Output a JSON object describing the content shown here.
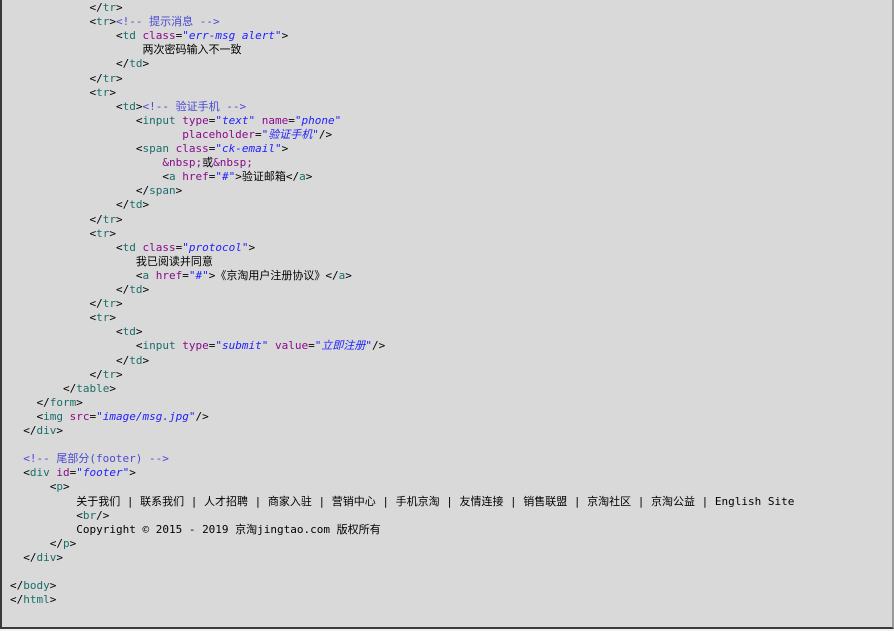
{
  "lines": [
    [
      {
        "t": "            ",
        "c": "sy"
      },
      {
        "t": "</",
        "c": "sy"
      },
      {
        "t": "tr",
        "c": "tg"
      },
      {
        "t": ">",
        "c": "sy"
      }
    ],
    [
      {
        "t": "            ",
        "c": "sy"
      },
      {
        "t": "<",
        "c": "sy"
      },
      {
        "t": "tr",
        "c": "tg"
      },
      {
        "t": ">",
        "c": "sy"
      },
      {
        "t": "<!-- 提示消息 -->",
        "c": "cm"
      }
    ],
    [
      {
        "t": "                ",
        "c": "sy"
      },
      {
        "t": "<",
        "c": "sy"
      },
      {
        "t": "td",
        "c": "tg"
      },
      {
        "t": " class",
        "c": "at"
      },
      {
        "t": "=",
        "c": "sy"
      },
      {
        "t": "\"err-msg alert\"",
        "c": "vl"
      },
      {
        "t": ">",
        "c": "sy"
      }
    ],
    [
      {
        "t": "                    ",
        "c": "sy"
      },
      {
        "t": "两次密码输入不一致",
        "c": "tx"
      }
    ],
    [
      {
        "t": "                ",
        "c": "sy"
      },
      {
        "t": "</",
        "c": "sy"
      },
      {
        "t": "td",
        "c": "tg"
      },
      {
        "t": ">",
        "c": "sy"
      }
    ],
    [
      {
        "t": "            ",
        "c": "sy"
      },
      {
        "t": "</",
        "c": "sy"
      },
      {
        "t": "tr",
        "c": "tg"
      },
      {
        "t": ">",
        "c": "sy"
      }
    ],
    [
      {
        "t": "            ",
        "c": "sy"
      },
      {
        "t": "<",
        "c": "sy"
      },
      {
        "t": "tr",
        "c": "tg"
      },
      {
        "t": ">",
        "c": "sy"
      }
    ],
    [
      {
        "t": "                ",
        "c": "sy"
      },
      {
        "t": "<",
        "c": "sy"
      },
      {
        "t": "td",
        "c": "tg"
      },
      {
        "t": ">",
        "c": "sy"
      },
      {
        "t": "<!-- 验证手机 -->",
        "c": "cm"
      }
    ],
    [
      {
        "t": "                   ",
        "c": "sy"
      },
      {
        "t": "<",
        "c": "sy"
      },
      {
        "t": "input",
        "c": "tg"
      },
      {
        "t": " type",
        "c": "at"
      },
      {
        "t": "=",
        "c": "sy"
      },
      {
        "t": "\"text\"",
        "c": "vl"
      },
      {
        "t": " name",
        "c": "at"
      },
      {
        "t": "=",
        "c": "sy"
      },
      {
        "t": "\"phone\"",
        "c": "vl"
      }
    ],
    [
      {
        "t": "                          ",
        "c": "sy"
      },
      {
        "t": "placeholder",
        "c": "at"
      },
      {
        "t": "=",
        "c": "sy"
      },
      {
        "t": "\"验证手机\"",
        "c": "vl"
      },
      {
        "t": "/>",
        "c": "sy"
      }
    ],
    [
      {
        "t": "                   ",
        "c": "sy"
      },
      {
        "t": "<",
        "c": "sy"
      },
      {
        "t": "span",
        "c": "tg"
      },
      {
        "t": " class",
        "c": "at"
      },
      {
        "t": "=",
        "c": "sy"
      },
      {
        "t": "\"ck-email\"",
        "c": "vl"
      },
      {
        "t": ">",
        "c": "sy"
      }
    ],
    [
      {
        "t": "                       ",
        "c": "sy"
      },
      {
        "t": "&nbsp;",
        "c": "at"
      },
      {
        "t": "或",
        "c": "tx"
      },
      {
        "t": "&nbsp;",
        "c": "at"
      }
    ],
    [
      {
        "t": "                       ",
        "c": "sy"
      },
      {
        "t": "<",
        "c": "sy"
      },
      {
        "t": "a",
        "c": "tg"
      },
      {
        "t": " href",
        "c": "at"
      },
      {
        "t": "=",
        "c": "sy"
      },
      {
        "t": "\"#\"",
        "c": "vl"
      },
      {
        "t": ">",
        "c": "sy"
      },
      {
        "t": "验证邮箱",
        "c": "tx"
      },
      {
        "t": "</",
        "c": "sy"
      },
      {
        "t": "a",
        "c": "tg"
      },
      {
        "t": ">",
        "c": "sy"
      }
    ],
    [
      {
        "t": "                   ",
        "c": "sy"
      },
      {
        "t": "</",
        "c": "sy"
      },
      {
        "t": "span",
        "c": "tg"
      },
      {
        "t": ">",
        "c": "sy"
      }
    ],
    [
      {
        "t": "                ",
        "c": "sy"
      },
      {
        "t": "</",
        "c": "sy"
      },
      {
        "t": "td",
        "c": "tg"
      },
      {
        "t": ">",
        "c": "sy"
      }
    ],
    [
      {
        "t": "            ",
        "c": "sy"
      },
      {
        "t": "</",
        "c": "sy"
      },
      {
        "t": "tr",
        "c": "tg"
      },
      {
        "t": ">",
        "c": "sy"
      }
    ],
    [
      {
        "t": "            ",
        "c": "sy"
      },
      {
        "t": "<",
        "c": "sy"
      },
      {
        "t": "tr",
        "c": "tg"
      },
      {
        "t": ">",
        "c": "sy"
      }
    ],
    [
      {
        "t": "                ",
        "c": "sy"
      },
      {
        "t": "<",
        "c": "sy"
      },
      {
        "t": "td",
        "c": "tg"
      },
      {
        "t": " class",
        "c": "at"
      },
      {
        "t": "=",
        "c": "sy"
      },
      {
        "t": "\"protocol\"",
        "c": "vl"
      },
      {
        "t": ">",
        "c": "sy"
      }
    ],
    [
      {
        "t": "                   ",
        "c": "sy"
      },
      {
        "t": "我已阅读并同意",
        "c": "tx"
      }
    ],
    [
      {
        "t": "                   ",
        "c": "sy"
      },
      {
        "t": "<",
        "c": "sy"
      },
      {
        "t": "a",
        "c": "tg"
      },
      {
        "t": " href",
        "c": "at"
      },
      {
        "t": "=",
        "c": "sy"
      },
      {
        "t": "\"#\"",
        "c": "vl"
      },
      {
        "t": ">",
        "c": "sy"
      },
      {
        "t": "《京淘用户注册协议》",
        "c": "tx"
      },
      {
        "t": "</",
        "c": "sy"
      },
      {
        "t": "a",
        "c": "tg"
      },
      {
        "t": ">",
        "c": "sy"
      }
    ],
    [
      {
        "t": "                ",
        "c": "sy"
      },
      {
        "t": "</",
        "c": "sy"
      },
      {
        "t": "td",
        "c": "tg"
      },
      {
        "t": ">",
        "c": "sy"
      }
    ],
    [
      {
        "t": "            ",
        "c": "sy"
      },
      {
        "t": "</",
        "c": "sy"
      },
      {
        "t": "tr",
        "c": "tg"
      },
      {
        "t": ">",
        "c": "sy"
      }
    ],
    [
      {
        "t": "            ",
        "c": "sy"
      },
      {
        "t": "<",
        "c": "sy"
      },
      {
        "t": "tr",
        "c": "tg"
      },
      {
        "t": ">",
        "c": "sy"
      }
    ],
    [
      {
        "t": "                ",
        "c": "sy"
      },
      {
        "t": "<",
        "c": "sy"
      },
      {
        "t": "td",
        "c": "tg"
      },
      {
        "t": ">",
        "c": "sy"
      }
    ],
    [
      {
        "t": "                   ",
        "c": "sy"
      },
      {
        "t": "<",
        "c": "sy"
      },
      {
        "t": "input",
        "c": "tg"
      },
      {
        "t": " type",
        "c": "at"
      },
      {
        "t": "=",
        "c": "sy"
      },
      {
        "t": "\"submit\"",
        "c": "vl"
      },
      {
        "t": " value",
        "c": "at"
      },
      {
        "t": "=",
        "c": "sy"
      },
      {
        "t": "\"立即注册\"",
        "c": "vl"
      },
      {
        "t": "/>",
        "c": "sy"
      }
    ],
    [
      {
        "t": "                ",
        "c": "sy"
      },
      {
        "t": "</",
        "c": "sy"
      },
      {
        "t": "td",
        "c": "tg"
      },
      {
        "t": ">",
        "c": "sy"
      }
    ],
    [
      {
        "t": "            ",
        "c": "sy"
      },
      {
        "t": "</",
        "c": "sy"
      },
      {
        "t": "tr",
        "c": "tg"
      },
      {
        "t": ">",
        "c": "sy"
      }
    ],
    [
      {
        "t": "        ",
        "c": "sy"
      },
      {
        "t": "</",
        "c": "sy"
      },
      {
        "t": "table",
        "c": "tg"
      },
      {
        "t": ">",
        "c": "sy"
      }
    ],
    [
      {
        "t": "    ",
        "c": "sy"
      },
      {
        "t": "</",
        "c": "sy"
      },
      {
        "t": "form",
        "c": "tg"
      },
      {
        "t": ">",
        "c": "sy"
      }
    ],
    [
      {
        "t": "    ",
        "c": "sy"
      },
      {
        "t": "<",
        "c": "sy"
      },
      {
        "t": "img",
        "c": "tg"
      },
      {
        "t": " src",
        "c": "at"
      },
      {
        "t": "=",
        "c": "sy"
      },
      {
        "t": "\"image/msg.jpg\"",
        "c": "vl"
      },
      {
        "t": "/>",
        "c": "sy"
      }
    ],
    [
      {
        "t": "  ",
        "c": "sy"
      },
      {
        "t": "</",
        "c": "sy"
      },
      {
        "t": "div",
        "c": "tg"
      },
      {
        "t": ">",
        "c": "sy"
      }
    ],
    [],
    [
      {
        "t": "  ",
        "c": "sy"
      },
      {
        "t": "<!-- 尾部分(footer) -->",
        "c": "cm"
      }
    ],
    [
      {
        "t": "  ",
        "c": "sy"
      },
      {
        "t": "<",
        "c": "sy"
      },
      {
        "t": "div",
        "c": "tg"
      },
      {
        "t": " id",
        "c": "at"
      },
      {
        "t": "=",
        "c": "sy"
      },
      {
        "t": "\"footer\"",
        "c": "vl"
      },
      {
        "t": ">",
        "c": "sy"
      }
    ],
    [
      {
        "t": "      ",
        "c": "sy"
      },
      {
        "t": "<",
        "c": "sy"
      },
      {
        "t": "p",
        "c": "tg"
      },
      {
        "t": ">",
        "c": "sy"
      }
    ],
    [
      {
        "t": "          ",
        "c": "sy"
      },
      {
        "t": "关于我们 | 联系我们 | 人才招聘 | 商家入驻 | 营销中心 | 手机京淘 | 友情连接 | 销售联盟 | 京淘社区 | 京淘公益 | English Site",
        "c": "tx"
      }
    ],
    [
      {
        "t": "          ",
        "c": "sy"
      },
      {
        "t": "<",
        "c": "sy"
      },
      {
        "t": "br",
        "c": "tg"
      },
      {
        "t": "/>",
        "c": "sy"
      }
    ],
    [
      {
        "t": "          ",
        "c": "sy"
      },
      {
        "t": "Copyright © 2015 - 2019 京淘jingtao.com 版权所有",
        "c": "tx"
      }
    ],
    [
      {
        "t": "      ",
        "c": "sy"
      },
      {
        "t": "</",
        "c": "sy"
      },
      {
        "t": "p",
        "c": "tg"
      },
      {
        "t": ">",
        "c": "sy"
      }
    ],
    [
      {
        "t": "  ",
        "c": "sy"
      },
      {
        "t": "</",
        "c": "sy"
      },
      {
        "t": "div",
        "c": "tg"
      },
      {
        "t": ">",
        "c": "sy"
      }
    ],
    [],
    [
      {
        "t": "</",
        "c": "sy"
      },
      {
        "t": "body",
        "c": "tg"
      },
      {
        "t": ">",
        "c": "sy"
      }
    ],
    [
      {
        "t": "</",
        "c": "sy"
      },
      {
        "t": "html",
        "c": "tg"
      },
      {
        "t": ">",
        "c": "sy"
      }
    ]
  ]
}
